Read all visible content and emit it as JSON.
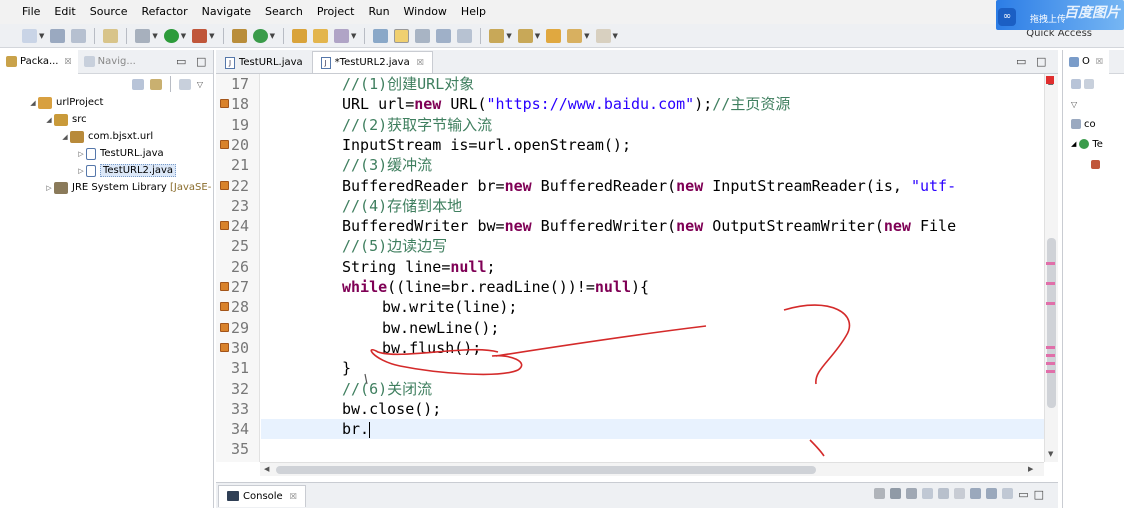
{
  "menu": [
    "File",
    "Edit",
    "Source",
    "Refactor",
    "Navigate",
    "Search",
    "Project",
    "Run",
    "Window",
    "Help"
  ],
  "toolbar": {
    "quick_access": "Quick Access",
    "upload_label": "拖拽上传",
    "watermark": "百度图片"
  },
  "package_explorer": {
    "tabs": [
      {
        "label": "Packa...",
        "close": "☒"
      },
      {
        "label": "Navig...",
        "close": ""
      }
    ],
    "tree": [
      {
        "label": "urlProject",
        "depth": 0
      },
      {
        "label": "src",
        "depth": 1
      },
      {
        "label": "com.bjsxt.url",
        "depth": 2
      },
      {
        "label": "TestURL.java",
        "depth": 3
      },
      {
        "label": "TestURL2.java",
        "depth": 3
      },
      {
        "label": "JRE System Library",
        "suffix": "[JavaSE-",
        "depth": 0
      }
    ]
  },
  "editor": {
    "tabs": [
      {
        "label": "TestURL.java",
        "active": false,
        "close": ""
      },
      {
        "label": "*TestURL2.java",
        "active": true,
        "close": "☒"
      }
    ]
  },
  "code_lines": [
    {
      "n": "17",
      "marker": false,
      "text": "//(1)创建URL对象"
    },
    {
      "n": "18",
      "marker": true,
      "text": "URL url=new URL(\"https://www.baidu.com\");//主页资源"
    },
    {
      "n": "19",
      "marker": false,
      "text": "//(2)获取字节输入流"
    },
    {
      "n": "20",
      "marker": true,
      "text": "InputStream is=url.openStream();"
    },
    {
      "n": "21",
      "marker": false,
      "text": "//(3)缓冲流"
    },
    {
      "n": "22",
      "marker": true,
      "text": "BufferedReader br=new BufferedReader(new InputStreamReader(is, \"utf-"
    },
    {
      "n": "23",
      "marker": false,
      "text": "//(4)存储到本地"
    },
    {
      "n": "24",
      "marker": true,
      "text": "BufferedWriter bw=new BufferedWriter(new OutputStreamWriter(new File"
    },
    {
      "n": "25",
      "marker": false,
      "text": "//(5)边读边写"
    },
    {
      "n": "26",
      "marker": false,
      "text": "String line=null;"
    },
    {
      "n": "27",
      "marker": true,
      "text": "while((line=br.readLine())!=null){"
    },
    {
      "n": "28",
      "marker": true,
      "text": "bw.write(line);"
    },
    {
      "n": "29",
      "marker": true,
      "text": "bw.newLine();"
    },
    {
      "n": "30",
      "marker": true,
      "text": "bw.flush();"
    },
    {
      "n": "31",
      "marker": false,
      "text": "}"
    },
    {
      "n": "32",
      "marker": false,
      "text": "//(6)关闭流"
    },
    {
      "n": "33",
      "marker": false,
      "text": "bw.close();"
    },
    {
      "n": "34",
      "marker": false,
      "text": "br."
    },
    {
      "n": "35",
      "marker": false,
      "text": ""
    }
  ],
  "outline": {
    "tabs": [
      "O"
    ],
    "rows": [
      "co",
      "Te"
    ]
  },
  "console": {
    "label": "Console",
    "close": "☒"
  },
  "colors": {
    "keyword": "#7f0055",
    "comment": "#3f7f5f",
    "string": "#2a00ff",
    "ink": "#d42a2a"
  }
}
